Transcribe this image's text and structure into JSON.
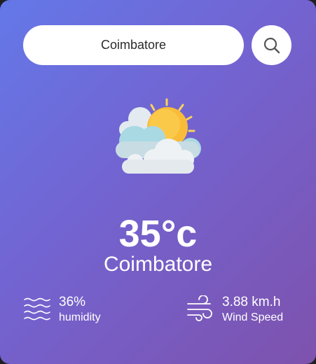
{
  "search": {
    "value": "Coimbatore",
    "placeholder": "",
    "button_icon": "search-icon"
  },
  "weather": {
    "icon": "sun-behind-clouds-icon",
    "temperature": "35°c",
    "city": "Coimbatore"
  },
  "details": {
    "humidity": {
      "icon": "humidity-waves-icon",
      "value": "36%",
      "label": "humidity"
    },
    "wind": {
      "icon": "wind-icon",
      "value": "3.88 km.h",
      "label": "Wind Speed"
    }
  },
  "colors": {
    "gradient_start": "#6478e8",
    "gradient_end": "#7e52ad",
    "text": "#ffffff",
    "input_background": "#ffffff",
    "sun": "#f9bc3a",
    "cloud": "#e7edf2"
  }
}
